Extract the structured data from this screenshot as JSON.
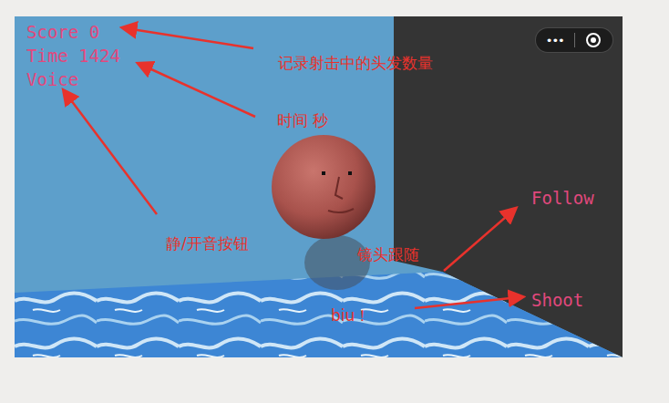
{
  "hud": {
    "score": "Score 0",
    "time": "Time 1424",
    "voice": "Voice"
  },
  "controls": [
    {
      "label": "Follow"
    },
    {
      "label": "Shoot"
    }
  ],
  "capsule": {
    "menu": "•••"
  },
  "annotations": [
    {
      "text": "记录射击中的头发数量"
    },
    {
      "text": "时间 秒"
    },
    {
      "text": "静/开音按钮"
    },
    {
      "text": "镜头跟随"
    },
    {
      "text": "biu！"
    }
  ]
}
